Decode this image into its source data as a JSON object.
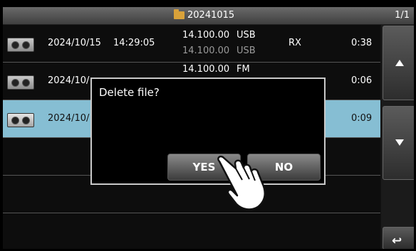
{
  "header": {
    "folder_name": "20241015",
    "page_indicator": "1/1"
  },
  "files": [
    {
      "date": "2024/10/15",
      "time": "14:29:05",
      "freq1": "14.100.00",
      "mode1": "USB",
      "freq2": "14.100.00",
      "mode2": "USB",
      "status": "RX",
      "duration": "0:38"
    },
    {
      "date": "2024/10/",
      "time": "",
      "freq1": "14.100.00",
      "mode1": "FM",
      "freq2": "",
      "mode2": "",
      "status": "",
      "duration": "0:06"
    },
    {
      "date": "2024/10/",
      "time": "",
      "freq1": "",
      "mode1": "",
      "freq2": "",
      "mode2": "",
      "status": "",
      "duration": "0:09",
      "selected": true
    }
  ],
  "dialog": {
    "message": "Delete file?",
    "yes_label": "YES",
    "no_label": "NO"
  },
  "side_buttons": {
    "up": "scroll-up",
    "down": "scroll-down",
    "back": "return"
  },
  "colors": {
    "selected_row": "#86bed3",
    "folder": "#d9a23a"
  }
}
